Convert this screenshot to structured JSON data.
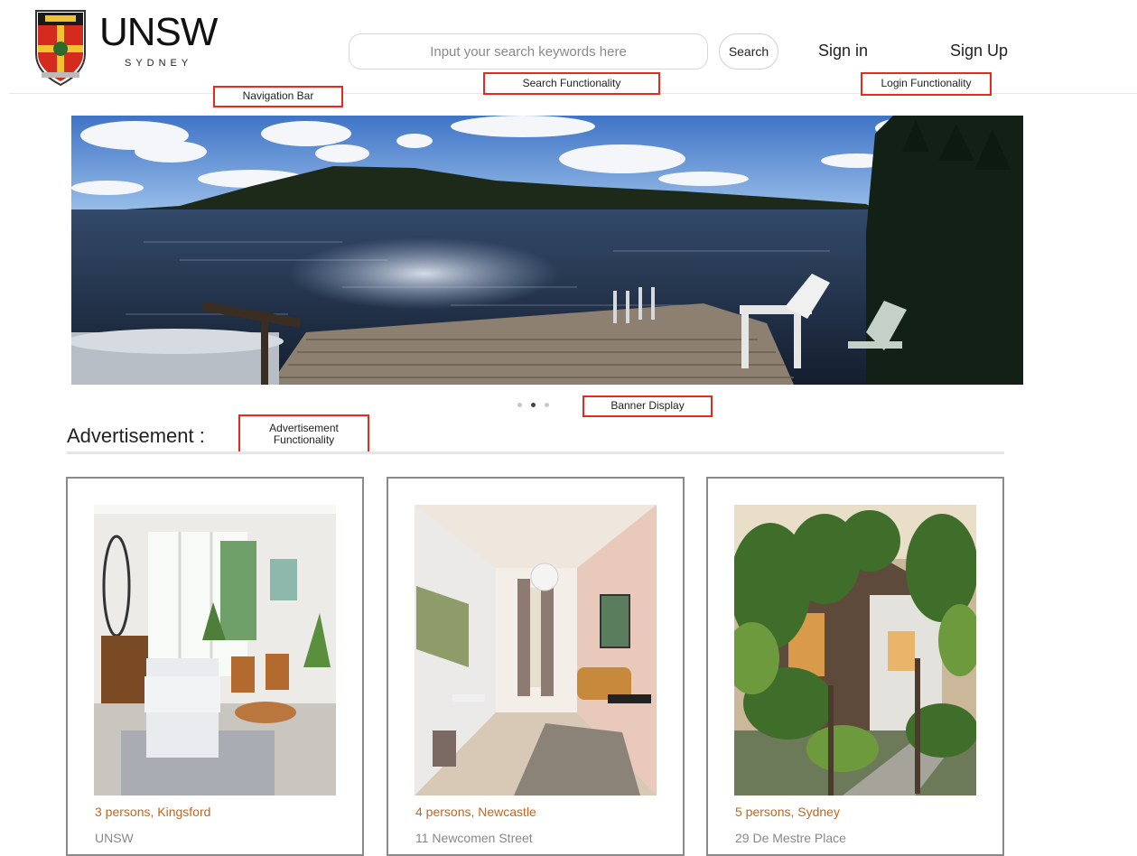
{
  "header": {
    "logo_text": "UNSW",
    "logo_sub": "SYDNEY",
    "search_placeholder": "Input your search keywords here",
    "search_button": "Search",
    "sign_in": "Sign in",
    "sign_up": "Sign Up"
  },
  "annotations": {
    "navigation": "Navigation Bar",
    "search": "Search Functionality",
    "login": "Login Functionality",
    "banner": "Banner Display",
    "advertisement": "Advertisement Functionality"
  },
  "banner": {
    "slide_count": 3,
    "active_slide": 1
  },
  "advertisement": {
    "title": "Advertisement :",
    "cards": [
      {
        "line1": "3 persons, Kingsford",
        "line2": "UNSW"
      },
      {
        "line1": "4 persons, Newcastle",
        "line2": "11 Newcomen Street"
      },
      {
        "line1": "5 persons, Sydney",
        "line2": "29 De Mestre Place"
      }
    ]
  },
  "colors": {
    "annotation_border": "#e8291c",
    "card_caption": "#c8651a",
    "unsw_red": "#d52b1e"
  }
}
